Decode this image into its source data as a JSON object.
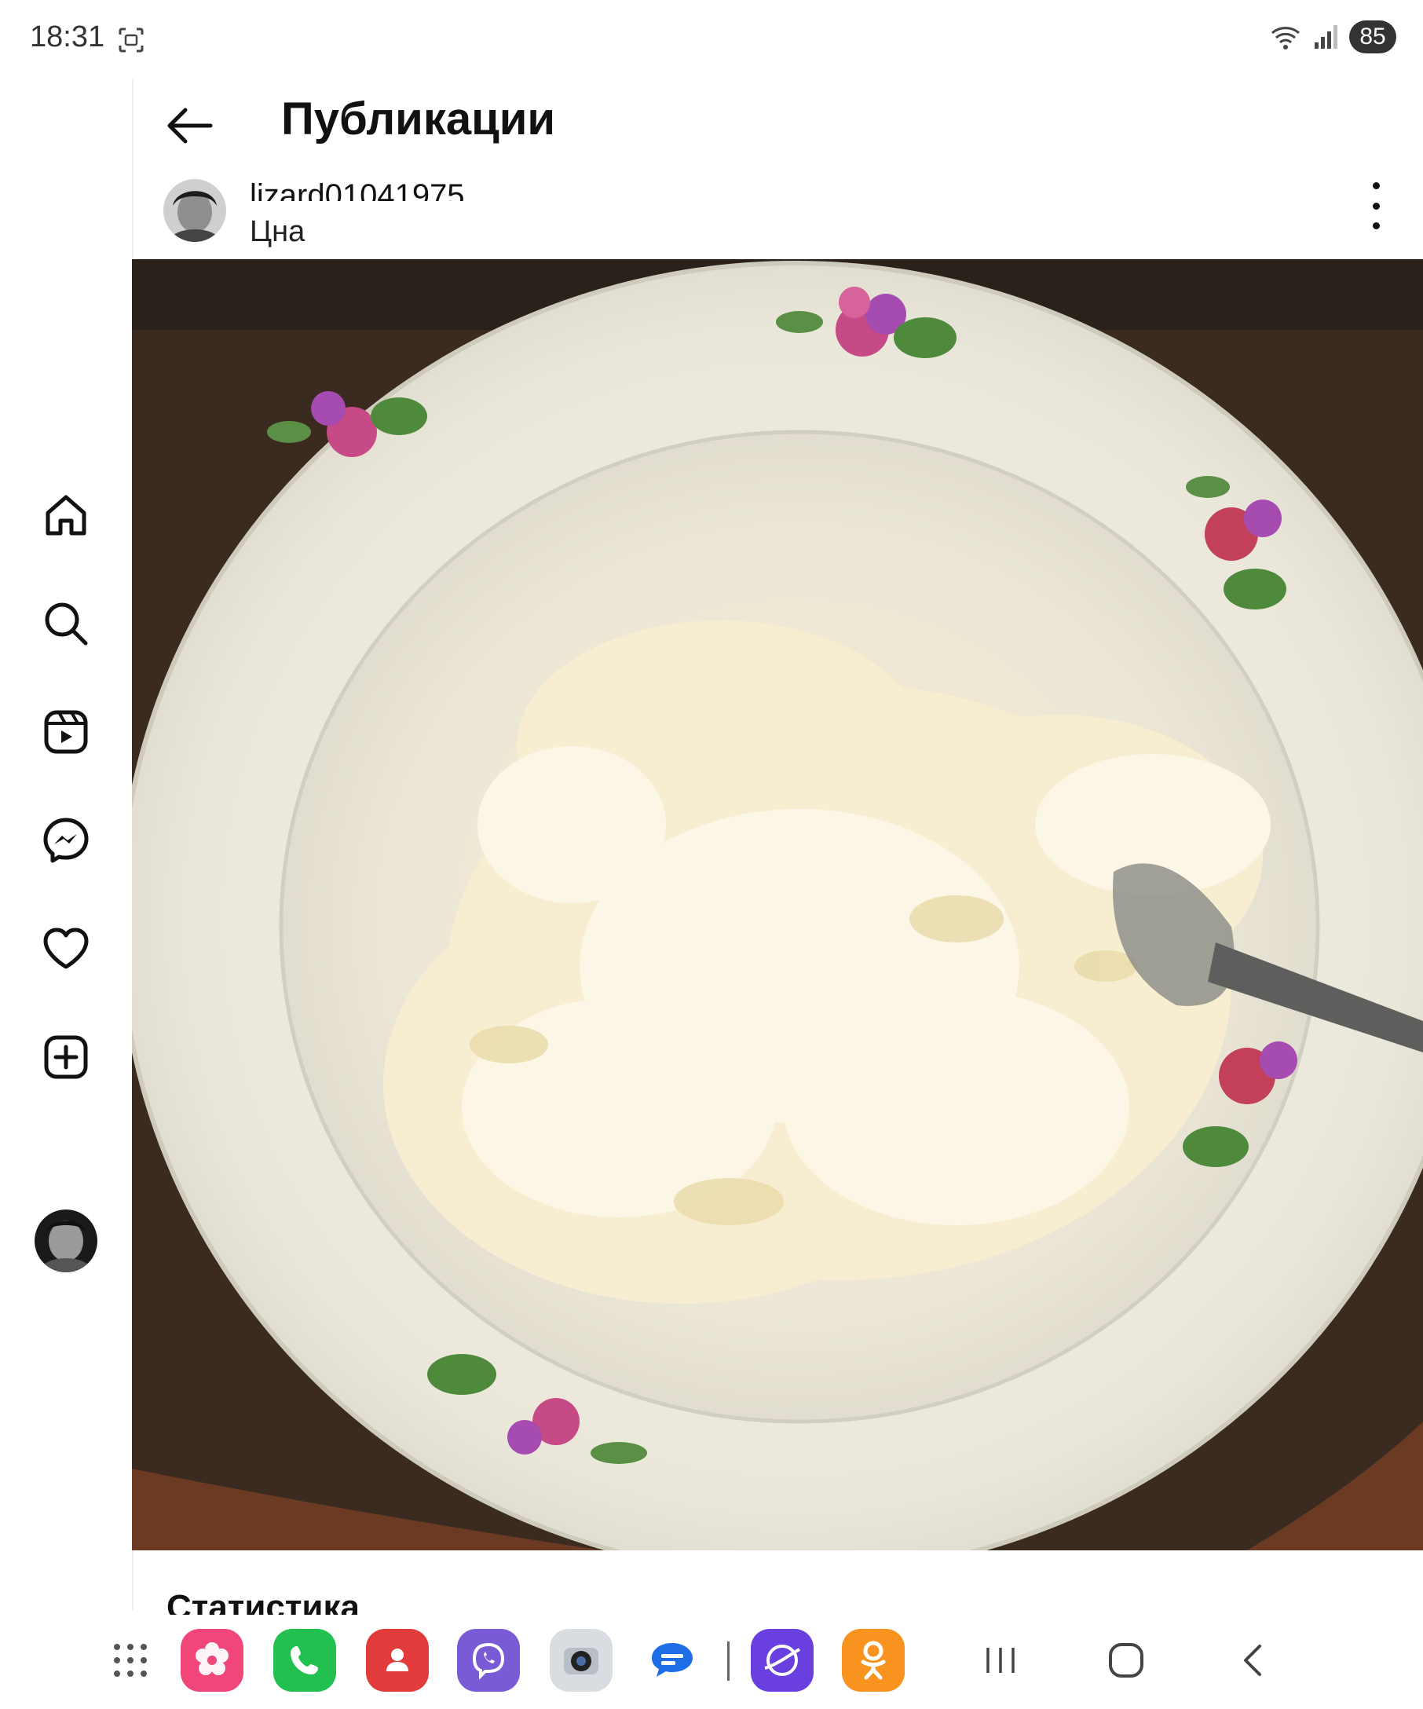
{
  "status_bar": {
    "time": "18:31",
    "battery": "85"
  },
  "header": {
    "title": "Публикации"
  },
  "post": {
    "username": "lizard01041975",
    "location": "Цна"
  },
  "stats": {
    "heading": "Статистика"
  },
  "nav_icons": [
    "home-icon",
    "search-icon",
    "reels-icon",
    "messenger-icon",
    "heart-icon",
    "create-icon",
    "profile-avatar"
  ],
  "dock_apps": [
    "app-grid-icon",
    "gallery-app-icon",
    "phone-app-icon",
    "contacts-app-icon",
    "viber-app-icon",
    "camera-app-icon",
    "messages-app-icon",
    "browser-app-icon",
    "odnoklassniki-app-icon"
  ],
  "colors": {
    "gallery": "#f0467a",
    "phone": "#22c04e",
    "contacts": "#e23b3b",
    "viber": "#7a5bd6",
    "messages": "#1e6ee8",
    "browser": "#6a3fe0",
    "ok": "#f7931e"
  }
}
